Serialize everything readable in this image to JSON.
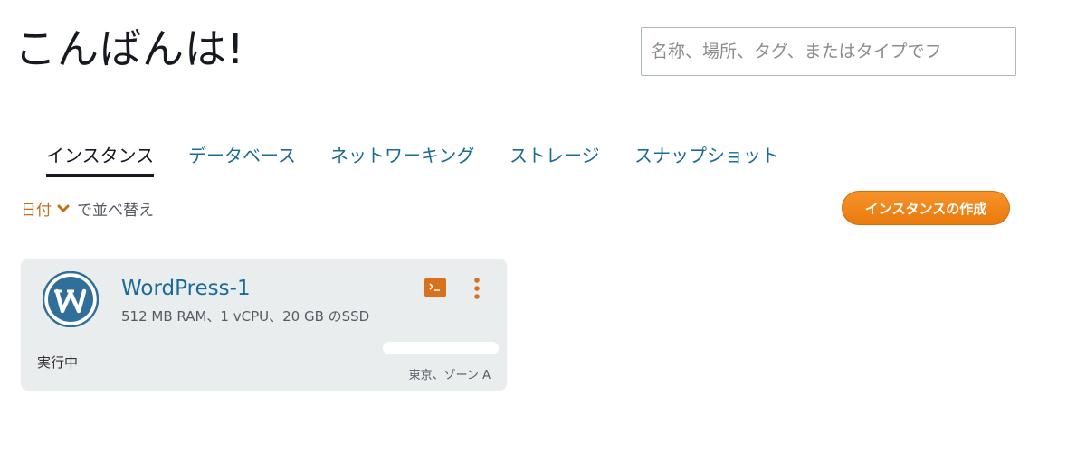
{
  "header": {
    "greeting": "こんばんは!"
  },
  "search": {
    "placeholder": "名称、場所、タグ、またはタイプでフ",
    "value": ""
  },
  "tabs": [
    {
      "label": "インスタンス",
      "active": true
    },
    {
      "label": "データベース",
      "active": false
    },
    {
      "label": "ネットワーキング",
      "active": false
    },
    {
      "label": "ストレージ",
      "active": false
    },
    {
      "label": "スナップショット",
      "active": false
    }
  ],
  "sort": {
    "key": "日付",
    "suffix": "で並べ替え",
    "icon": "chevron-down-icon"
  },
  "actions": {
    "create_instance": "インスタンスの作成"
  },
  "instances": [
    {
      "name": "WordPress-1",
      "spec": "512 MB RAM、1 vCPU、20 GB のSSD",
      "status": "実行中",
      "location": "東京、ゾーン A",
      "icon": "wordpress-logo-icon"
    }
  ],
  "colors": {
    "accent_orange": "#ec7211",
    "link_blue": "#1a6c96",
    "card_bg": "#eaeded",
    "active_tab": "#16191f"
  }
}
